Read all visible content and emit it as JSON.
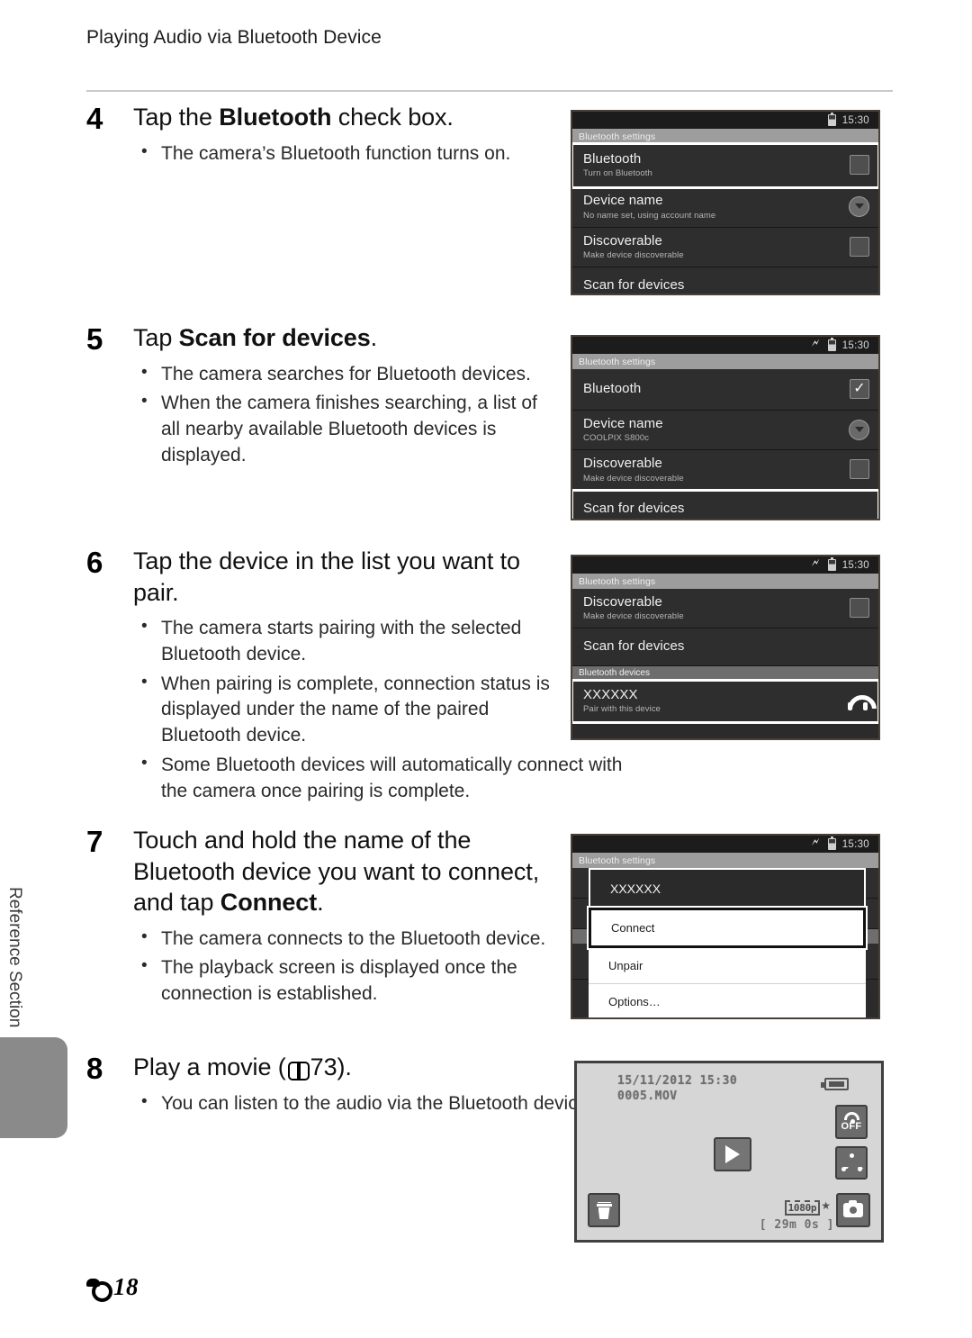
{
  "header": {
    "running_title": "Playing Audio via Bluetooth Device"
  },
  "side_tab": {
    "label": "Reference Section"
  },
  "footer": {
    "mark": "reference-symbol",
    "page": "18"
  },
  "steps": [
    {
      "number": "4",
      "title_pre": "Tap the ",
      "title_bold": "Bluetooth",
      "title_post": " check box.",
      "bullets": [
        "The camera’s Bluetooth function turns on."
      ]
    },
    {
      "number": "5",
      "title_pre": "Tap ",
      "title_bold": "Scan for devices",
      "title_post": ".",
      "bullets": [
        "The camera searches for Bluetooth devices.",
        "When the camera finishes searching, a list of all nearby available Bluetooth devices is displayed."
      ]
    },
    {
      "number": "6",
      "title_pre": "Tap the device in the list you want to pair.",
      "title_bold": "",
      "title_post": "",
      "bullets": [
        "The camera starts pairing with the selected Bluetooth device.",
        "When pairing is complete, connection status is displayed under the name of the paired Bluetooth device.",
        "Some Bluetooth devices will automatically connect with the camera once pairing is complete."
      ]
    },
    {
      "number": "7",
      "title_pre": "Touch and hold the name of the Bluetooth device you want to connect, and tap ",
      "title_bold": "Connect",
      "title_post": ".",
      "bullets": [
        "The camera connects to the Bluetooth device.",
        "The playback screen is displayed once the connection is established."
      ]
    },
    {
      "number": "8",
      "title_pre": "Play a movie (",
      "title_ref": "73",
      "title_post": ").",
      "bullets": [
        "You can listen to the audio via the Bluetooth device."
      ]
    }
  ],
  "shot4": {
    "status": {
      "time": "15:30",
      "bluetooth_icon": false,
      "battery_icon": true
    },
    "title_bar": "Bluetooth settings",
    "rows": [
      {
        "label": "Bluetooth",
        "sub": "Turn on Bluetooth",
        "control": "checkbox-unchecked-highlighted"
      },
      {
        "label": "Device name",
        "sub": "No name set, using account name",
        "control": "dropdown-circle"
      },
      {
        "label": "Discoverable",
        "sub": "Make device discoverable",
        "control": "checkbox-unchecked"
      },
      {
        "label": "Scan for devices",
        "sub": "",
        "control": "none"
      }
    ]
  },
  "shot5": {
    "status": {
      "time": "15:30",
      "bluetooth_icon": true,
      "battery_icon": true
    },
    "title_bar": "Bluetooth settings",
    "rows": [
      {
        "label": "Bluetooth",
        "sub": "",
        "control": "checkbox-checked"
      },
      {
        "label": "Device name",
        "sub": "COOLPIX S800c",
        "control": "dropdown-circle"
      },
      {
        "label": "Discoverable",
        "sub": "Make device discoverable",
        "control": "checkbox-unchecked"
      },
      {
        "label": "Scan for devices",
        "sub": "",
        "control": "none",
        "highlighted": true
      }
    ]
  },
  "shot6": {
    "status": {
      "time": "15:30",
      "bluetooth_icon": true,
      "battery_icon": true
    },
    "title_bar": "Bluetooth settings",
    "rows": [
      {
        "label": "Discoverable",
        "sub": "Make device discoverable",
        "control": "checkbox-unchecked"
      },
      {
        "label": "Scan for devices",
        "sub": "",
        "control": "none"
      }
    ],
    "section_bar": "Bluetooth devices",
    "devices": [
      {
        "label": "XXXXXX",
        "sub": "Pair with this device",
        "control": "headset-icon",
        "highlighted": true
      }
    ]
  },
  "shot7": {
    "status": {
      "time": "15:30",
      "bluetooth_icon": true,
      "battery_icon": true
    },
    "title_bar": "Bluetooth settings",
    "menu_header": "XXXXXX",
    "menu_items": [
      {
        "label": "Connect",
        "selected": true
      },
      {
        "label": "Unpair",
        "selected": false
      },
      {
        "label": "Options…",
        "selected": false
      }
    ]
  },
  "shot8": {
    "datetime": "15/11/2012 15:30",
    "filename": "0005.MOV",
    "wifi_state": "OFF",
    "movie_quality": "1080p",
    "duration": "29m  0s",
    "buttons": [
      "play-button",
      "wifi-off-button",
      "share-button",
      "delete-button",
      "camera-mode-button"
    ]
  }
}
